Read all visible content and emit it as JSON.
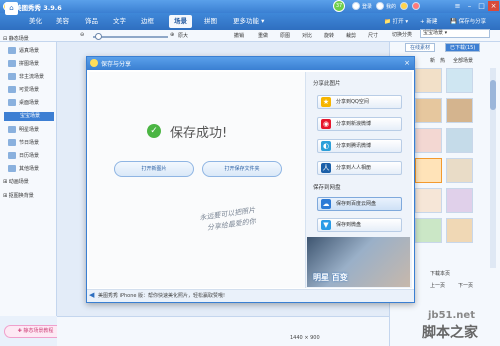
{
  "app": {
    "title": "美图秀秀 3.9.6",
    "level": "37"
  },
  "titlebar": {
    "tray": [
      "登录",
      "我的"
    ]
  },
  "tabs": [
    "美化",
    "美容",
    "饰品",
    "文字",
    "边框",
    "场景",
    "拼图",
    "更多功能 ▾"
  ],
  "active_tab": "场景",
  "tab_right": {
    "open": "打开",
    "new": "新建",
    "save": "保存与分享"
  },
  "toolbar": {
    "zoom_label": "原大",
    "tools": [
      "撤销",
      "重做",
      "原图",
      "对比",
      "旋转",
      "裁剪",
      "尺寸"
    ]
  },
  "left_panel": {
    "heading": "静态场景",
    "items": [
      "逼真场景",
      "拼图场景",
      "非主流场景",
      "可爱场景",
      "桌面场景",
      "宝宝场景",
      "明星场景",
      "节日场景",
      "日历场景",
      "其他场景"
    ],
    "selected": "宝宝场景",
    "section2": "动画场景",
    "section3": "抠图换背景",
    "bottom_button": "静态场景教程"
  },
  "right_panel": {
    "category_label": "切换分类",
    "category_value": "宝宝场景",
    "tabs": [
      "在线素材",
      "已下载(15)"
    ],
    "filters": [
      "新",
      "热",
      "全部场景"
    ],
    "bottom": [
      "下载本页",
      "上一页",
      "下一页"
    ]
  },
  "dialog": {
    "title": "保存与分享",
    "success": "保存成功!",
    "open_image": "打开新图片",
    "open_folder": "打开保存文件夹",
    "handwriting": [
      "永远要可以把照片",
      "分享给最爱的你"
    ],
    "share_heading": "分享此图片",
    "share_buttons": [
      "分享到QQ空间",
      "分享到新浪微博",
      "分享到腾讯微博",
      "分享到人人相册"
    ],
    "cloud_heading": "保存到网盘",
    "cloud_buttons": [
      "保存到百度云网盘",
      "保存到微盘"
    ],
    "banner_caption": "明星 百变",
    "footer": "美图秀秀 iPhone 版：帮你快速美化照片，轻松赢取赞哦!"
  },
  "status": {
    "canvas_size": "1440 × 900"
  },
  "watermark": {
    "line1": "jb51.net",
    "line2": "脚本之家"
  },
  "colors": {
    "primary": "#3a7fd2",
    "success": "#4bb543",
    "tab_bg": "#2f6fc0"
  }
}
